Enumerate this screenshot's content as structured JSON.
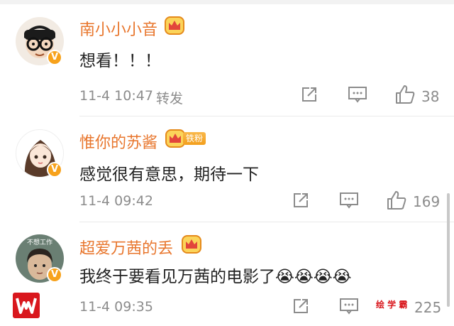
{
  "comments": [
    {
      "name": "南小小小音",
      "text": "想看！！！",
      "time": "11-4 10:47",
      "forward": "转发",
      "likes": "38"
    },
    {
      "name": "惟你的苏酱",
      "fan_badge": "铁粉",
      "text": "感觉很有意思，期待一下",
      "time": "11-4 09:42",
      "likes": "169"
    },
    {
      "name": "超爱万茜的丢",
      "avatar_text": "不想工作",
      "text": "我终于要看见万茜的电影了😭😭😭😭",
      "time": "11-4 09:35",
      "likes": "225"
    }
  ],
  "watermark": "绘 学 霸",
  "colors": {
    "name": "#e8762d",
    "badge": "#f7a21c",
    "text": "#222222",
    "meta": "#8c8c8c",
    "brand": "#d9171d"
  },
  "icons": [
    "crown-icon",
    "verified-badge-icon",
    "share-icon",
    "comment-icon",
    "thumbs-up-icon",
    "app-logo-icon"
  ]
}
